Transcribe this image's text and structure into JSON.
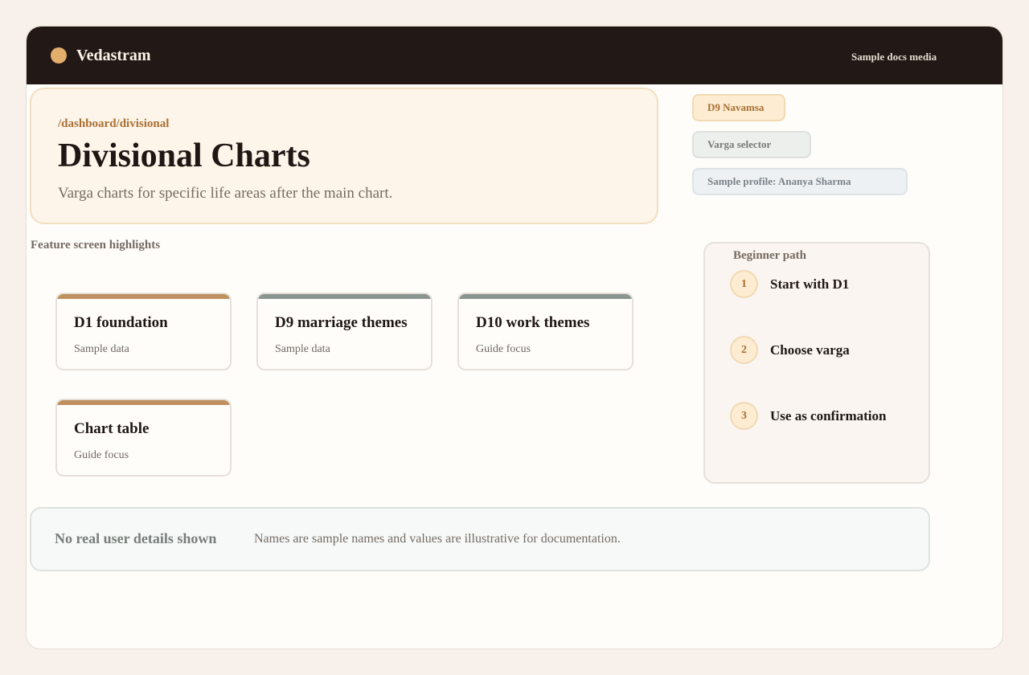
{
  "header": {
    "brand": "Vedastram",
    "right_text": "Sample docs media"
  },
  "hero": {
    "path": "/dashboard/divisional",
    "title": "Divisional Charts",
    "subtitle": "Varga charts for specific life areas after the main chart."
  },
  "chips": [
    {
      "label": "D9 Navamsa"
    },
    {
      "label": "Varga selector"
    },
    {
      "label": "Sample profile: Ananya Sharma"
    }
  ],
  "highlights": {
    "title": "Feature screen highlights",
    "cards": [
      {
        "title": "D1 foundation",
        "subtitle": "Sample data",
        "accent": "#bf8f5f"
      },
      {
        "title": "D9 marriage themes",
        "subtitle": "Sample data",
        "accent": "#8a9590"
      },
      {
        "title": "D10 work themes",
        "subtitle": "Guide focus",
        "accent": "#8a9590"
      },
      {
        "title": "Chart table",
        "subtitle": "Guide focus",
        "accent": "#bf8f5f"
      }
    ]
  },
  "beginner": {
    "title": "Beginner path",
    "steps": [
      {
        "num": "1",
        "label": "Start with D1"
      },
      {
        "num": "2",
        "label": "Choose varga"
      },
      {
        "num": "3",
        "label": "Use as confirmation"
      }
    ]
  },
  "notice": {
    "title": "No real user details shown",
    "text": "Names are sample names and values are illustrative for documentation."
  },
  "colors": {
    "topbar": "#221815",
    "accent": "#e3ad6b",
    "hero_bg": "#fef5ea",
    "link": "#a86f33"
  }
}
